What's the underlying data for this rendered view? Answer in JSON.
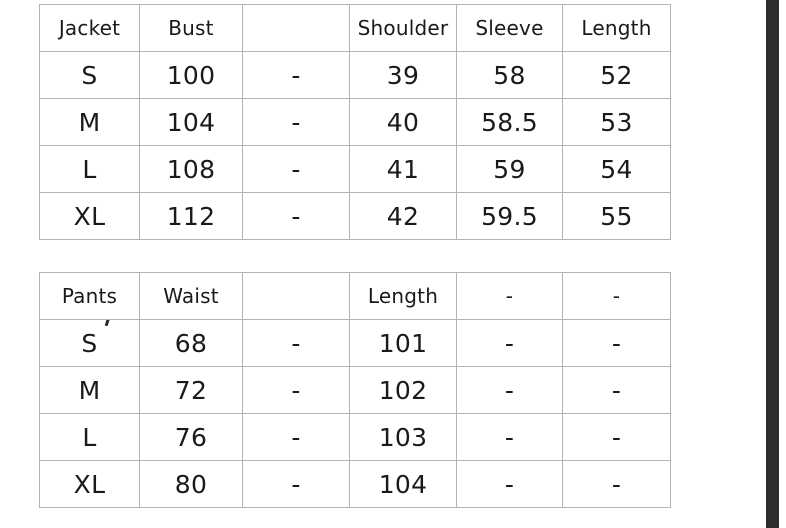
{
  "page": {
    "background_color": "#ffffff",
    "border_color": "#b4b4b4",
    "text_color": "#1a1a1a",
    "edge_strip_color": "#2e2e2e"
  },
  "tables": [
    {
      "id": "jacket",
      "name": "jacket-size-table",
      "headers": [
        "Jacket",
        "Bust",
        "",
        "Shoulder",
        "Sleeve",
        "Length"
      ],
      "rows": [
        [
          "S",
          "100",
          "-",
          "39",
          "58",
          "52"
        ],
        [
          "M",
          "104",
          "-",
          "40",
          "58.5",
          "53"
        ],
        [
          "L",
          "108",
          "-",
          "41",
          "59",
          "54"
        ],
        [
          "XL",
          "112",
          "-",
          "42",
          "59.5",
          "55"
        ]
      ]
    },
    {
      "id": "pants",
      "name": "pants-size-table",
      "headers": [
        "Pants",
        "Waist",
        "",
        "Length",
        "-",
        "-"
      ],
      "rows": [
        [
          "S",
          "68",
          "-",
          "101",
          "-",
          "-"
        ],
        [
          "M",
          "72",
          "-",
          "102",
          "-",
          "-"
        ],
        [
          "L",
          "76",
          "-",
          "103",
          "-",
          "-"
        ],
        [
          "XL",
          "80",
          "-",
          "104",
          "-",
          "-"
        ]
      ]
    }
  ]
}
